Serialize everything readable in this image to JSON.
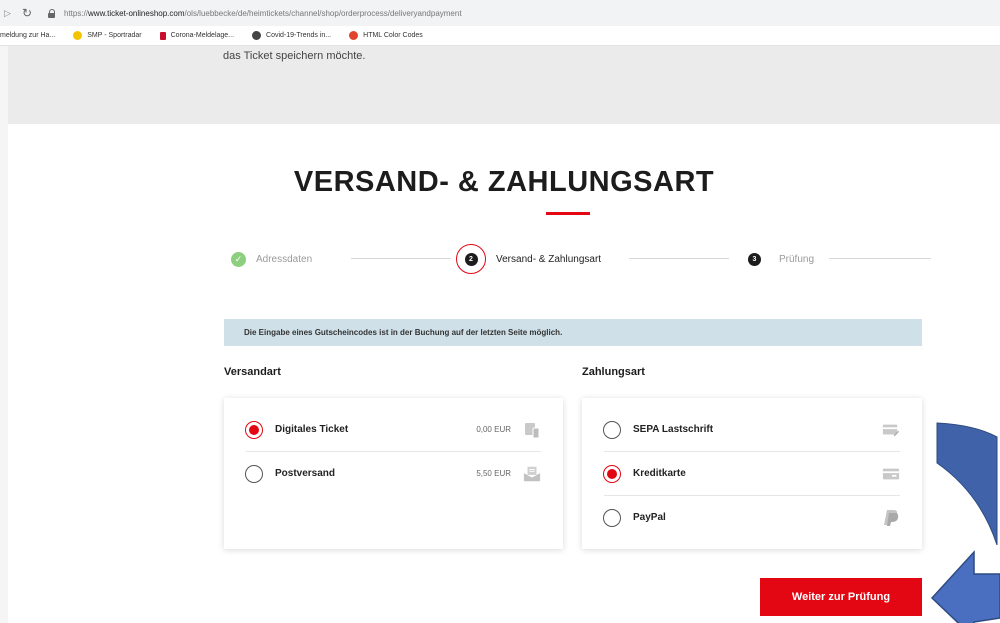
{
  "browser": {
    "url_prefix": "https://",
    "url_host": "www.ticket-onlineshop.com",
    "url_path": "/ols/luebbecke/de/heimtickets/channel/shop/orderprocess/deliveryandpayment",
    "bookmarks": [
      {
        "label": "meldung zur Ha...",
        "color": ""
      },
      {
        "label": "SMP - Sportradar",
        "color": "#f5c400"
      },
      {
        "label": "Corona-Meldelage...",
        "color": "#c8102e"
      },
      {
        "label": "Covid-19-Trends in...",
        "color": "#444444"
      },
      {
        "label": "HTML Color Codes",
        "color": "#e0452b"
      }
    ]
  },
  "top_text": "das Ticket speichern möchte.",
  "heading": "VERSAND- & ZAHLUNGSART",
  "stepper": {
    "steps": [
      {
        "label": "Adressdaten",
        "state": "done",
        "number": ""
      },
      {
        "label": "Versand- & Zahlungsart",
        "state": "active",
        "number": "2"
      },
      {
        "label": "Prüfung",
        "state": "pending",
        "number": "3"
      }
    ]
  },
  "info_message": "Die Eingabe eines Gutscheincodes ist in der Buchung auf der letzten Seite möglich.",
  "shipping": {
    "title": "Versandart",
    "options": [
      {
        "label": "Digitales Ticket",
        "price": "0,00 EUR",
        "icon": "mobile-ticket-icon",
        "selected": true
      },
      {
        "label": "Postversand",
        "price": "5,50 EUR",
        "icon": "mail-envelope-icon",
        "selected": false
      }
    ]
  },
  "payment": {
    "title": "Zahlungsart",
    "options": [
      {
        "label": "SEPA Lastschrift",
        "icon": "sepa-card-icon",
        "selected": false
      },
      {
        "label": "Kreditkarte",
        "icon": "credit-card-icon",
        "selected": true
      },
      {
        "label": "PayPal",
        "icon": "paypal-icon",
        "selected": false
      }
    ]
  },
  "submit_label": "Weiter zur Prüfung",
  "colors": {
    "accent": "#e30613",
    "info_bg": "#cfe0e8",
    "arrow": "#3f62a8"
  }
}
